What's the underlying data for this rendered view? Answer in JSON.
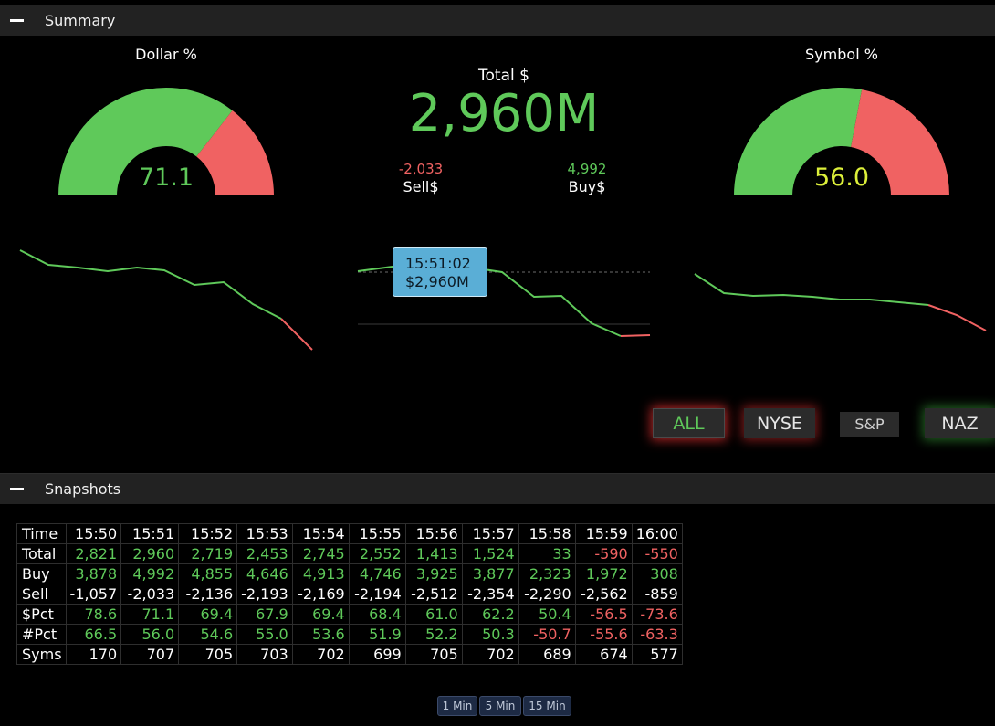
{
  "summary": {
    "title": "Summary",
    "dollar_pct": {
      "label": "Dollar %",
      "value": "71.1",
      "fraction": 0.711
    },
    "symbol_pct": {
      "label": "Symbol %",
      "value": "56.0",
      "fraction": 0.56
    },
    "total": {
      "label": "Total $",
      "value": "2,960M"
    },
    "sell": {
      "value": "-2,033",
      "label": "Sell$"
    },
    "buy": {
      "value": "4,992",
      "label": "Buy$"
    },
    "tooltip": {
      "time": "15:51:02",
      "value": "$2,960M"
    },
    "filters": [
      "ALL",
      "NYSE",
      "S&P",
      "NAZ"
    ]
  },
  "colors": {
    "positive": "#5fc95a",
    "negative": "#f06262",
    "symbol_value": "#dcef3a",
    "tooltip_bg": "#5aaed6"
  },
  "snapshots": {
    "title": "Snapshots",
    "columns": [
      "Time",
      "15:50",
      "15:51",
      "15:52",
      "15:53",
      "15:54",
      "15:55",
      "15:56",
      "15:57",
      "15:58",
      "15:59",
      "16:00"
    ],
    "rows": [
      {
        "label": "Total",
        "values": [
          "2,821",
          "2,960",
          "2,719",
          "2,453",
          "2,745",
          "2,552",
          "1,413",
          "1,524",
          "33",
          "-590",
          "-550"
        ]
      },
      {
        "label": "Buy",
        "values": [
          "3,878",
          "4,992",
          "4,855",
          "4,646",
          "4,913",
          "4,746",
          "3,925",
          "3,877",
          "2,323",
          "1,972",
          "308"
        ]
      },
      {
        "label": "Sell",
        "values": [
          "-1,057",
          "-2,033",
          "-2,136",
          "-2,193",
          "-2,169",
          "-2,194",
          "-2,512",
          "-2,354",
          "-2,290",
          "-2,562",
          "-859"
        ]
      },
      {
        "label": "$Pct",
        "values": [
          "78.6",
          "71.1",
          "69.4",
          "67.9",
          "69.4",
          "68.4",
          "61.0",
          "62.2",
          "50.4",
          "-56.5",
          "-73.6"
        ]
      },
      {
        "label": "#Pct",
        "values": [
          "66.5",
          "56.0",
          "54.6",
          "55.0",
          "53.6",
          "51.9",
          "52.2",
          "50.3",
          "-50.7",
          "-55.6",
          "-63.3"
        ]
      },
      {
        "label": "Syms",
        "values": [
          "170",
          "707",
          "705",
          "703",
          "702",
          "699",
          "705",
          "702",
          "689",
          "674",
          "577"
        ]
      }
    ],
    "intervals": [
      "1 Min",
      "5 Min",
      "15 Min"
    ]
  }
}
